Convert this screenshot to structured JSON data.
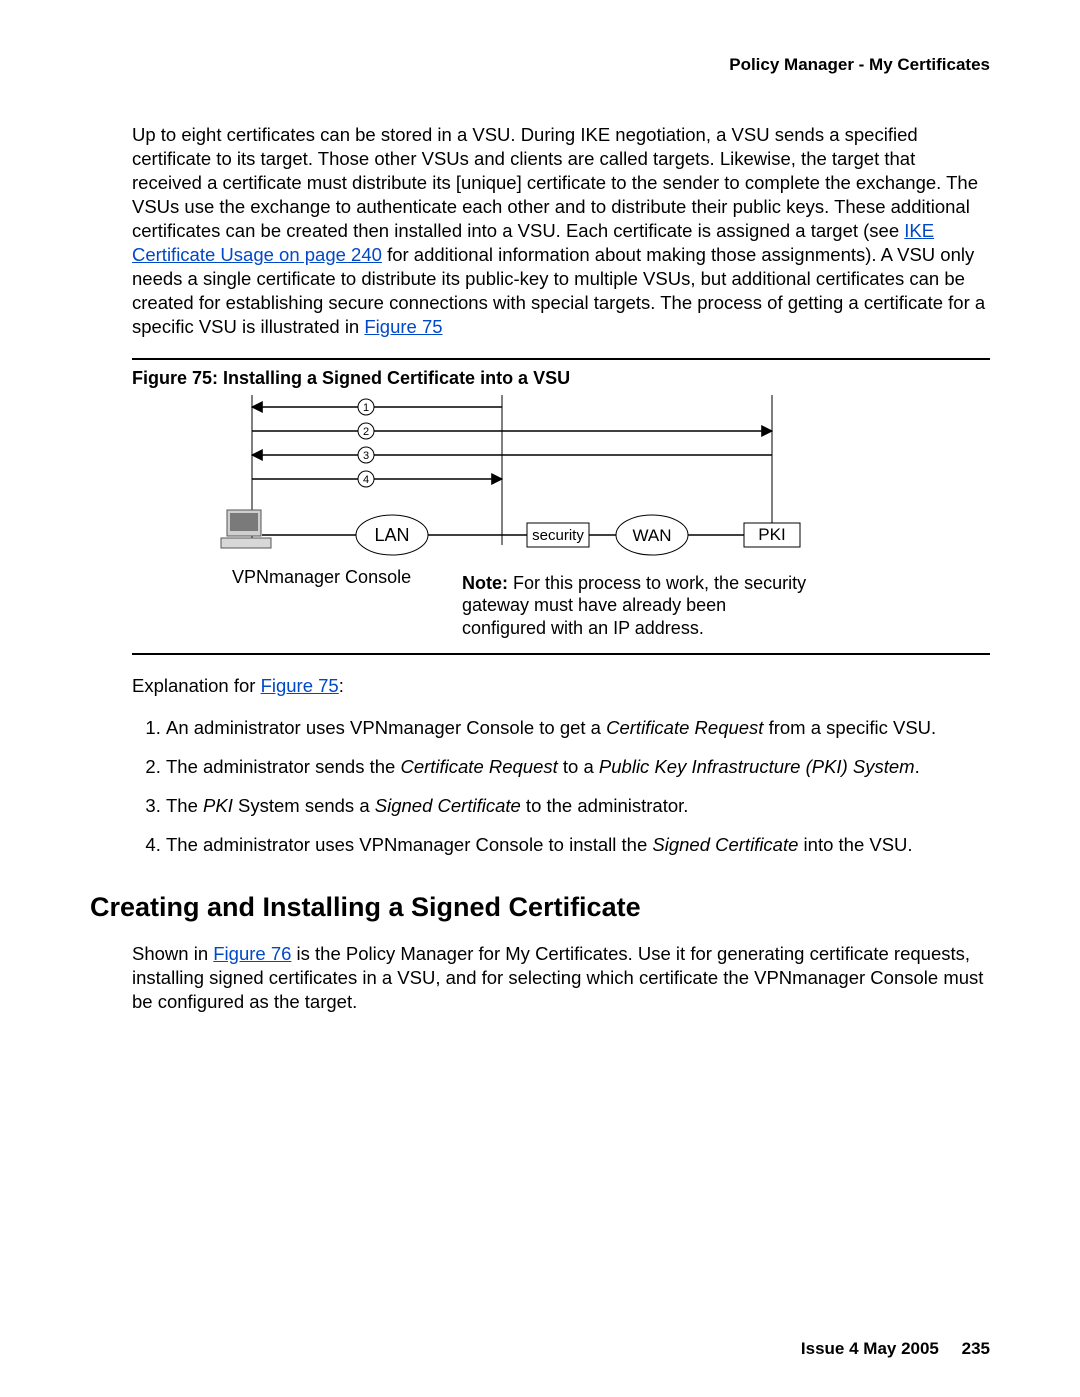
{
  "running_head": "Policy Manager - My Certificates",
  "para1_a": "Up to eight certificates can be stored in a VSU. During IKE negotiation, a VSU sends a specified certificate to its target. Those other VSUs and clients are called targets. Likewise, the target that received a certificate must distribute its [unique] certificate to the sender to complete the exchange. The VSUs use the exchange to authenticate each other and to distribute their public keys. These additional certificates can be created then installed into a VSU. Each certificate is assigned a target (see ",
  "link1": "IKE Certificate Usage on page 240",
  "para1_b": " for additional information about making those assignments). A VSU only needs a single certificate to distribute its public-key to multiple VSUs, but additional certificates can be created for establishing secure connections with special targets. The process of getting a certificate for a specific VSU is illustrated in ",
  "link2": "Figure 75",
  "fig75_caption": "Figure 75: Installing a Signed Certificate into a VSU",
  "diagram": {
    "lan": "LAN",
    "wan": "WAN",
    "security": "security",
    "pki": "PKI",
    "console": "VPNmanager Console",
    "steps": [
      "1",
      "2",
      "3",
      "4"
    ]
  },
  "fig_note_bold": "Note:",
  "fig_note_rest": " For this process to work, the security gateway must have already been configured with an IP address.",
  "explain_prefix": "Explanation for ",
  "explain_link": "Figure 75",
  "explain_suffix": ":",
  "steps": {
    "s1_a": "An administrator uses VPNmanager Console to get a ",
    "s1_i": "Certificate Request",
    "s1_b": " from a specific VSU.",
    "s2_a": "The administrator sends the ",
    "s2_i1": "Certificate Request",
    "s2_b": " to a ",
    "s2_i2": "Public Key Infrastructure (PKI) System",
    "s2_c": ".",
    "s3_a": "The ",
    "s3_i1": "PKI",
    "s3_b": " System sends a ",
    "s3_i2": "Signed Certificate",
    "s3_c": " to the administrator.",
    "s4_a": "The administrator uses VPNmanager Console to install the ",
    "s4_i": "Signed Certificate",
    "s4_b": " into the VSU."
  },
  "h2": "Creating and Installing a Signed Certificate",
  "para2_a": "Shown in ",
  "para2_link": "Figure 76",
  "para2_b": " is the Policy Manager for My Certificates. Use it for generating certificate requests, installing signed certificates in a VSU, and for selecting which certificate the VPNmanager Console must be configured as the target.",
  "footer_issue": "Issue 4   May 2005",
  "footer_page": "235"
}
